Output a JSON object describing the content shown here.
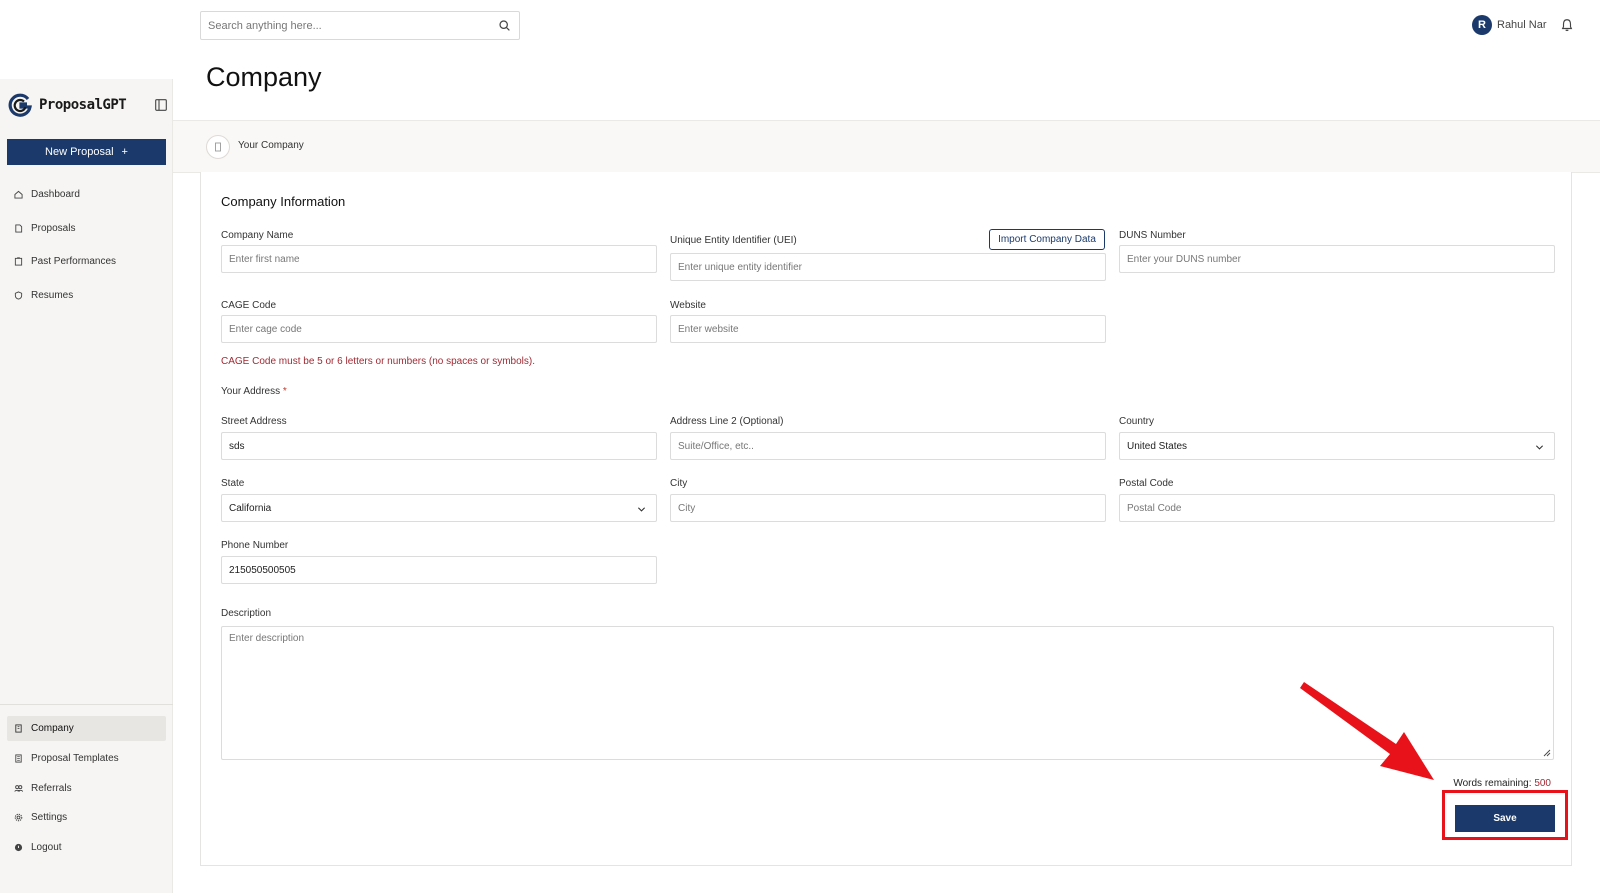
{
  "topbar": {
    "search_placeholder": "Search anything here...",
    "user_initial": "R",
    "user_name": "Rahul Nar"
  },
  "sidebar": {
    "brand": "ProposalGPT",
    "new_proposal_label": "New Proposal",
    "primary_items": [
      {
        "label": "Dashboard",
        "icon": "home-icon"
      },
      {
        "label": "Proposals",
        "icon": "document-icon"
      },
      {
        "label": "Past Performances",
        "icon": "clipboard-icon"
      },
      {
        "label": "Resumes",
        "icon": "shield-icon"
      }
    ],
    "secondary_items": [
      {
        "label": "Company",
        "icon": "building-icon",
        "active": true
      },
      {
        "label": "Proposal Templates",
        "icon": "template-icon"
      },
      {
        "label": "Referrals",
        "icon": "users-icon"
      },
      {
        "label": "Settings",
        "icon": "gear-icon"
      },
      {
        "label": "Logout",
        "icon": "logout-icon"
      }
    ]
  },
  "page": {
    "title": "Company",
    "breadcrumb": "Your Company"
  },
  "form": {
    "section_title": "Company Information",
    "company_name": {
      "label": "Company Name",
      "placeholder": "Enter first name",
      "value": ""
    },
    "uei": {
      "label": "Unique Entity Identifier (UEI)",
      "placeholder": "Enter unique entity identifier",
      "value": ""
    },
    "import_button": "Import Company Data",
    "duns": {
      "label": "DUNS Number",
      "placeholder": "Enter your DUNS number",
      "value": ""
    },
    "cage": {
      "label": "CAGE Code",
      "placeholder": "Enter cage code",
      "value": "",
      "error": "CAGE Code must be 5 or 6 letters or numbers (no spaces or symbols)."
    },
    "website": {
      "label": "Website",
      "placeholder": "Enter website",
      "value": ""
    },
    "address_heading": "Your Address",
    "address_required_mark": "*",
    "street": {
      "label": "Street Address",
      "placeholder": "",
      "value": "sds"
    },
    "address2": {
      "label": "Address Line 2 (Optional)",
      "placeholder": "Suite/Office, etc..",
      "value": ""
    },
    "country": {
      "label": "Country",
      "value": "United States"
    },
    "state": {
      "label": "State",
      "value": "California"
    },
    "city": {
      "label": "City",
      "placeholder": "City",
      "value": ""
    },
    "postal": {
      "label": "Postal Code",
      "placeholder": "Postal Code",
      "value": ""
    },
    "phone": {
      "label": "Phone Number",
      "placeholder": "",
      "value": "215050500505"
    },
    "description": {
      "label": "Description",
      "placeholder": "Enter description",
      "value": ""
    },
    "words_remaining_label": "Words remaining:",
    "words_remaining_count": "500",
    "save_label": "Save"
  },
  "colors": {
    "brand_navy": "#1b3a6b",
    "error_red": "#a02b34",
    "annotation_red": "#e8131a"
  }
}
